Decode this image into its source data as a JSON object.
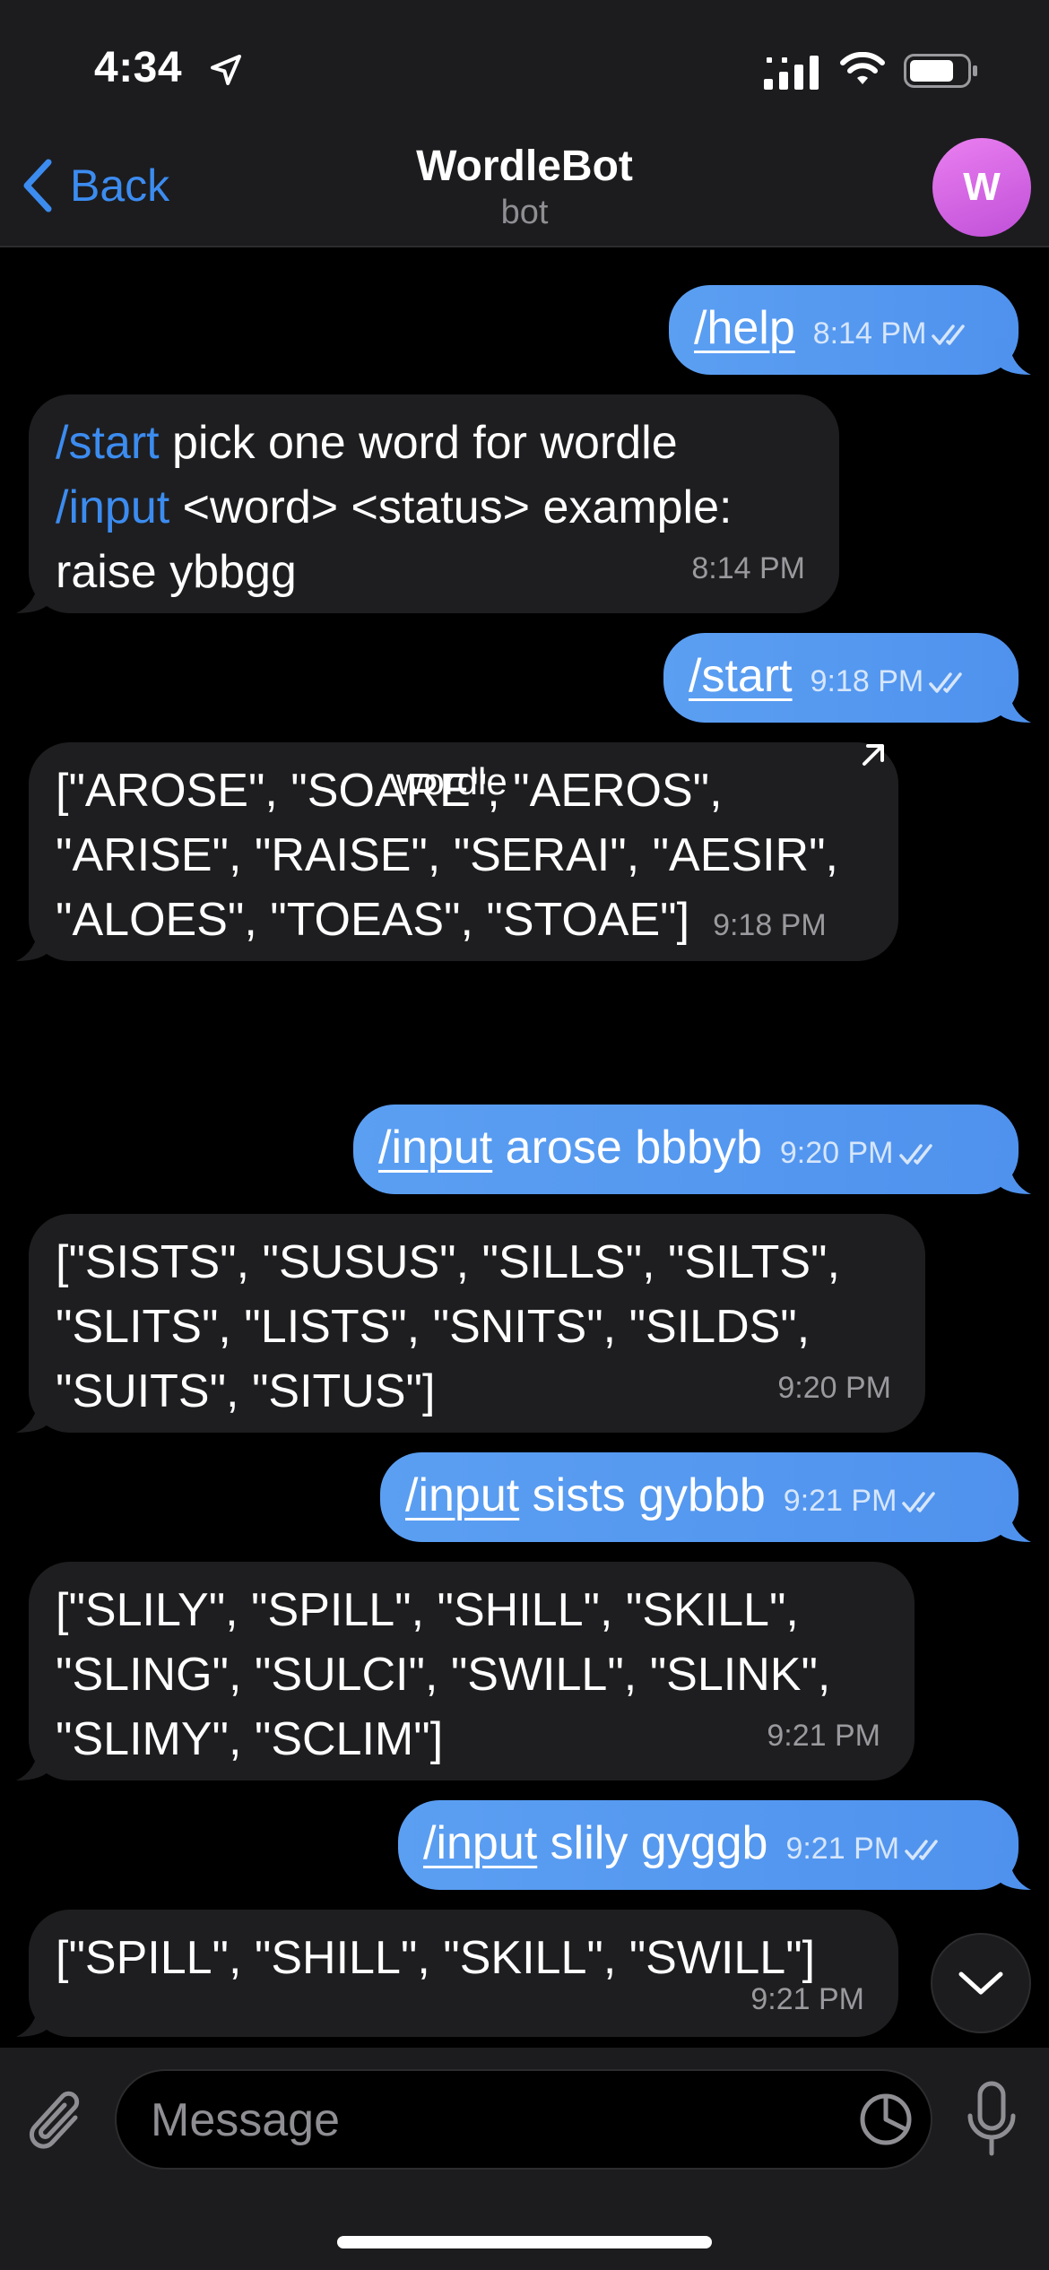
{
  "status_bar": {
    "time": "4:34"
  },
  "nav": {
    "back_label": "Back",
    "title": "WordleBot",
    "subtitle": "bot",
    "avatar_letter": "W"
  },
  "messages": [
    {
      "direction": "outgoing",
      "command": "/help",
      "text": "",
      "time": "8:14 PM"
    },
    {
      "direction": "incoming",
      "lines": [
        {
          "command": "/start",
          "text": " pick one word for wordle"
        },
        {
          "command": "/input",
          "text": " <word> <status> example:"
        },
        {
          "command": "",
          "text": "raise ybbgg"
        }
      ],
      "time": "8:14 PM"
    },
    {
      "direction": "outgoing",
      "command": "/start",
      "text": "",
      "time": "9:18 PM"
    },
    {
      "direction": "incoming",
      "lines": [
        {
          "text": "[\"AROSE\", \"SOARE\", \"AEROS\","
        },
        {
          "text": "\"ARISE\", \"RAISE\", \"SERAI\", \"AESIR\","
        },
        {
          "text": "\"ALOES\", \"TOEAS\", \"STOAE\"]"
        }
      ],
      "time": "9:18 PM"
    },
    {
      "direction": "outgoing",
      "command": "/input",
      "text": " arose bbbyb",
      "time": "9:20 PM"
    },
    {
      "direction": "incoming",
      "lines": [
        {
          "text": "[\"SISTS\", \"SUSUS\", \"SILLS\", \"SILTS\","
        },
        {
          "text": "\"SLITS\", \"LISTS\", \"SNITS\", \"SILDS\","
        },
        {
          "text": "\"SUITS\", \"SITUS\"]"
        }
      ],
      "time": "9:20 PM"
    },
    {
      "direction": "outgoing",
      "command": "/input",
      "text": " sists gybbb",
      "time": "9:21 PM"
    },
    {
      "direction": "incoming",
      "lines": [
        {
          "text": "[\"SLILY\", \"SPILL\", \"SHILL\", \"SKILL\","
        },
        {
          "text": "\"SLING\", \"SULCI\", \"SWILL\", \"SLINK\","
        },
        {
          "text": "\"SLIMY\", \"SCLIM\"]"
        }
      ],
      "time": "9:21 PM"
    },
    {
      "direction": "outgoing",
      "command": "/input",
      "text": " slily gyggb",
      "time": "9:21 PM"
    },
    {
      "direction": "incoming",
      "lines": [
        {
          "text": "[\"SPILL\", \"SHILL\", \"SKILL\", \"SWILL\"]"
        }
      ],
      "time": "9:21 PM"
    }
  ],
  "inline_label": "wordle",
  "composer": {
    "placeholder": "Message"
  },
  "colors": {
    "accent": "#3c8cf0",
    "outgoing_bubble": "#5b9ff2",
    "incoming_bubble": "#1e1e20",
    "avatar": "#d468e6"
  },
  "icons": [
    "location-arrow-icon",
    "signal-icon",
    "wifi-icon",
    "battery-icon",
    "chevron-left-icon",
    "double-check-icon",
    "arrow-up-right-icon",
    "chevron-down-icon",
    "paperclip-icon",
    "sticker-icon",
    "microphone-icon"
  ]
}
